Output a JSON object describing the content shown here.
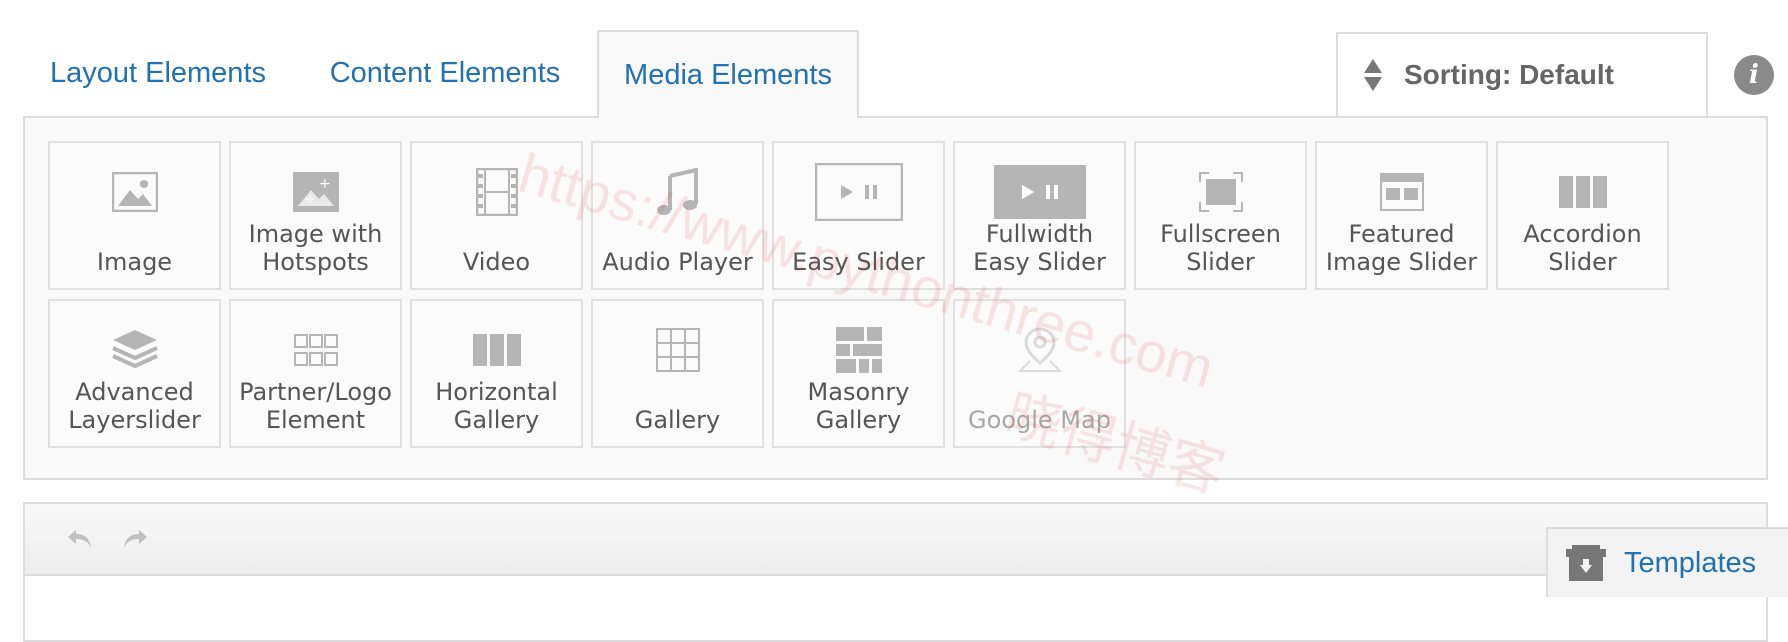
{
  "tabs": [
    {
      "label": "Layout Elements",
      "active": false
    },
    {
      "label": "Content Elements",
      "active": false
    },
    {
      "label": "Media Elements",
      "active": true
    }
  ],
  "sorting": {
    "label": "Sorting: Default"
  },
  "elements": [
    {
      "label": "Image",
      "icon": "image-icon"
    },
    {
      "label": "Image with\nHotspots",
      "icon": "image-hotspots-icon"
    },
    {
      "label": "Video",
      "icon": "film-icon"
    },
    {
      "label": "Audio Player",
      "icon": "music-note-icon"
    },
    {
      "label": "Easy Slider",
      "icon": "easy-slider-icon"
    },
    {
      "label": "Fullwidth\nEasy Slider",
      "icon": "fullwidth-slider-icon"
    },
    {
      "label": "Fullscreen\nSlider",
      "icon": "fullscreen-icon"
    },
    {
      "label": "Featured\nImage Slider",
      "icon": "featured-slider-icon"
    },
    {
      "label": "Accordion\nSlider",
      "icon": "accordion-icon"
    },
    {
      "label": "Advanced\nLayerslider",
      "icon": "layers-icon"
    },
    {
      "label": "Partner/Logo\nElement",
      "icon": "logo-grid-icon"
    },
    {
      "label": "Horizontal\nGallery",
      "icon": "horizontal-gallery-icon"
    },
    {
      "label": "Gallery",
      "icon": "grid-icon"
    },
    {
      "label": "Masonry\nGallery",
      "icon": "masonry-icon"
    },
    {
      "label": "Google Map",
      "icon": "map-pin-icon",
      "disabled": true
    }
  ],
  "templates": {
    "label": "Templates"
  },
  "watermark": {
    "line1": "https://www.pythonthree.com",
    "line2": "晓得博客"
  }
}
